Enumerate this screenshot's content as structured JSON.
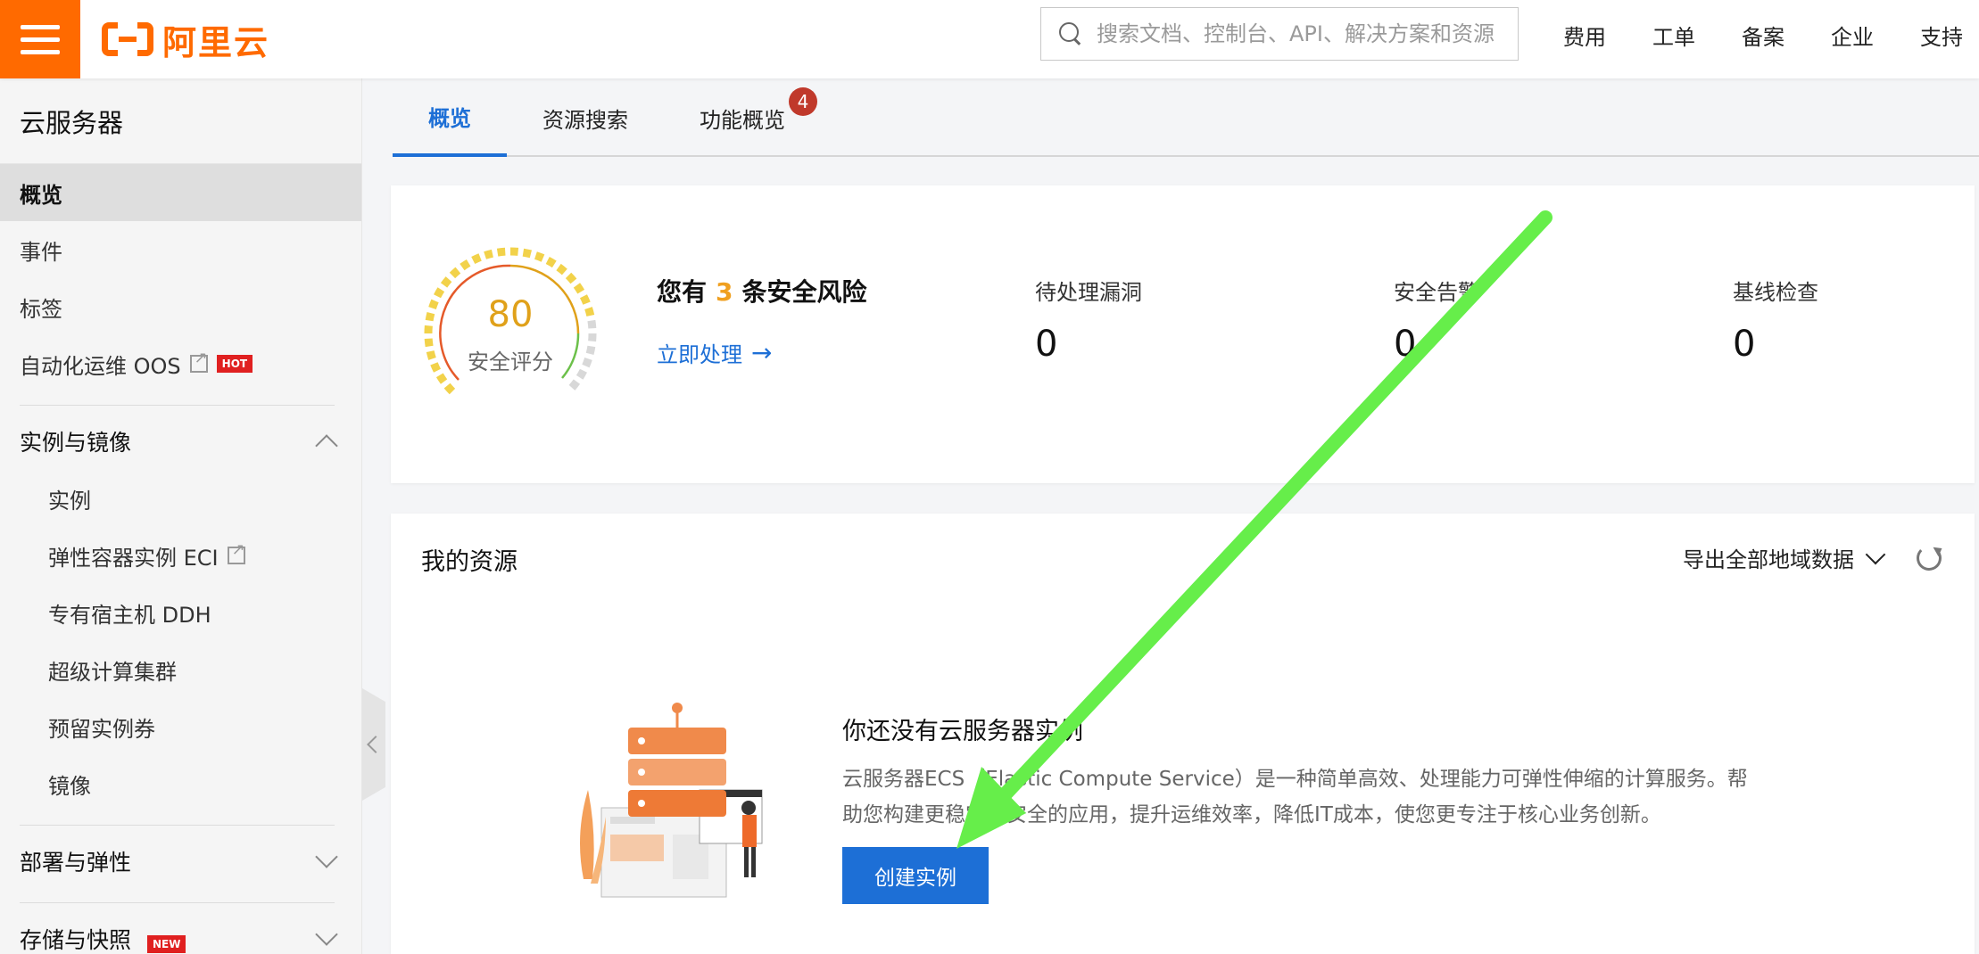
{
  "brand": {
    "logo_text": "阿里云"
  },
  "search": {
    "placeholder": "搜索文档、控制台、API、解决方案和资源"
  },
  "topnav": [
    "费用",
    "工单",
    "备案",
    "企业",
    "支持"
  ],
  "sidebar": {
    "title": "云服务器",
    "items": [
      {
        "label": "概览"
      },
      {
        "label": "事件"
      },
      {
        "label": "标签"
      },
      {
        "label": "自动化运维 OOS",
        "badge": "HOT"
      }
    ],
    "group_instances": {
      "label": "实例与镜像",
      "items": [
        "实例",
        "弹性容器实例 ECI",
        "专有宿主机 DDH",
        "超级计算集群",
        "预留实例券",
        "镜像"
      ]
    },
    "group_deploy": {
      "label": "部署与弹性"
    },
    "group_storage": {
      "label": "存储与快照",
      "badge": "NEW"
    }
  },
  "tabs": [
    {
      "label": "概览"
    },
    {
      "label": "资源搜索"
    },
    {
      "label": "功能概览",
      "badge": "4"
    }
  ],
  "security": {
    "score": "80",
    "score_label": "安全评分",
    "risk_prefix": "您有",
    "risk_count": "3",
    "risk_suffix": "条安全风险",
    "action": "立即处理",
    "stats": [
      {
        "label": "待处理漏洞",
        "value": "0"
      },
      {
        "label": "安全告警",
        "value": "0"
      },
      {
        "label": "基线检查",
        "value": "0"
      }
    ]
  },
  "resources": {
    "title": "我的资源",
    "export_label": "导出全部地域数据",
    "empty_title": "你还没有云服务器实例",
    "empty_desc": "云服务器ECS（Elastic Compute Service）是一种简单高效、处理能力可弹性伸缩的计算服务。帮助您构建更稳定、安全的应用，提升运维效率，降低IT成本，使您更专注于核心业务创新。",
    "create_button": "创建实例"
  },
  "colors": {
    "brand": "#ff6a00",
    "primary": "#1d6fd6",
    "annotation": "#66ee4a"
  }
}
